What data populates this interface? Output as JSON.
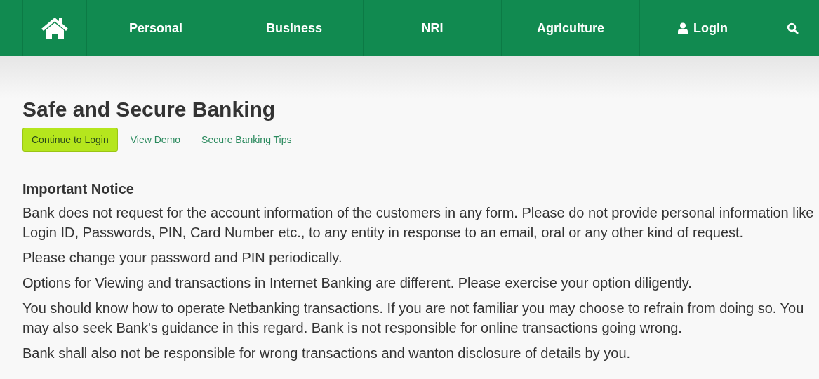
{
  "nav": {
    "items": [
      {
        "kind": "home"
      },
      {
        "kind": "text",
        "label": "Personal"
      },
      {
        "kind": "text",
        "label": "Business"
      },
      {
        "kind": "text",
        "label": "NRI"
      },
      {
        "kind": "text",
        "label": "Agriculture"
      },
      {
        "kind": "user",
        "label": "Login"
      },
      {
        "kind": "search"
      }
    ]
  },
  "title": "Safe and Secure Banking",
  "actions": [
    {
      "kind": "button",
      "label": "Continue to Login"
    },
    {
      "kind": "link",
      "label": "View Demo"
    },
    {
      "kind": "link",
      "label": "Secure Banking Tips"
    }
  ],
  "notice": {
    "heading": "Important Notice",
    "paragraphs": [
      "Bank does not request for the account information of the customers in any form. Please do not provide personal information like Login ID, Passwords, PIN, Card Number etc., to any entity in response to an email, oral or any other kind of request.",
      "Please change your password and PIN periodically.",
      "Options for Viewing and transactions in Internet Banking are different. Please exercise your option diligently.",
      "You should know how to operate Netbanking transactions. If you are not familiar you may choose to refrain from doing so. You may also seek Bank's guidance in this regard. Bank is not responsible for online transactions going wrong.",
      "Bank shall also not be responsible for wrong transactions and wanton disclosure of details by you."
    ]
  }
}
